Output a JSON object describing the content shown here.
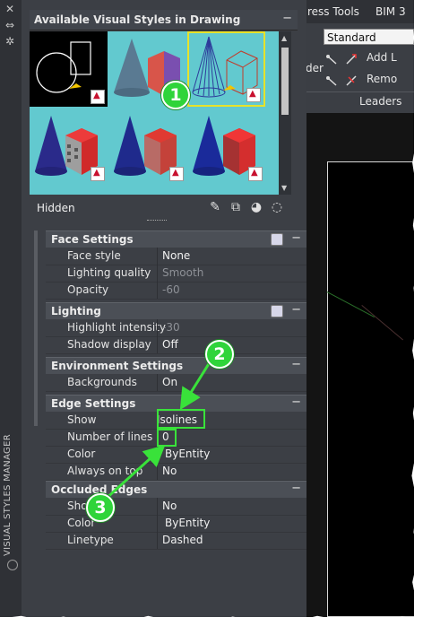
{
  "ribbon": {
    "tabs": [
      "ress Tools",
      "BIM 3"
    ],
    "dropdown_value": "Standard",
    "add_label": "Add L",
    "remove_label": "Remo",
    "left_fragment": "der",
    "panel_label": "Leaders"
  },
  "palette": {
    "side_title": "VISUAL STYLES MANAGER",
    "header_title": "Available Visual Styles in Drawing",
    "collapse_symbol": "−",
    "current_style": "Hidden",
    "thumbnails": [
      {
        "style": "2D Wireframe",
        "selected": false
      },
      {
        "style": "Conceptual",
        "selected": false
      },
      {
        "style": "Hidden",
        "selected": true
      },
      {
        "style": "X-Ray",
        "selected": false
      },
      {
        "style": "Realistic",
        "selected": false
      },
      {
        "style": "Shaded",
        "selected": false
      }
    ],
    "footer_icons": [
      "create-style-icon",
      "apply-style-icon",
      "export-tool-palette-icon",
      "delete-style-icon"
    ]
  },
  "face_settings": {
    "title": "Face Settings",
    "rows": [
      {
        "label": "Face style",
        "value": "None",
        "dim": false
      },
      {
        "label": "Lighting quality",
        "value": "Smooth",
        "dim": true
      },
      {
        "label": "Opacity",
        "value": "-60",
        "dim": true
      }
    ]
  },
  "lighting": {
    "title": "Lighting",
    "rows": [
      {
        "label": "Highlight intensity",
        "value": "-30",
        "dim": true
      },
      {
        "label": "Shadow display",
        "value": "Off",
        "dim": false
      }
    ]
  },
  "environment": {
    "title": "Environment Settings",
    "rows": [
      {
        "label": "Backgrounds",
        "value": "On",
        "dim": false
      }
    ]
  },
  "edge_settings": {
    "title": "Edge Settings",
    "rows": [
      {
        "label": "Show",
        "value": "Isolines",
        "dim": false
      },
      {
        "label": "Number of lines",
        "value": "0",
        "dim": false
      },
      {
        "label": "Color",
        "value": "ByEntity",
        "dim": false
      },
      {
        "label": "Always on top",
        "value": "No",
        "dim": false
      }
    ]
  },
  "occluded_edges": {
    "title": "Occluded Edges",
    "rows": [
      {
        "label": "Show",
        "value": "No",
        "dim": false
      },
      {
        "label": "Color",
        "value": "ByEntity",
        "dim": false
      },
      {
        "label": "Linetype",
        "value": "Dashed",
        "dim": false
      }
    ]
  },
  "annotations": {
    "callout_1": "1",
    "callout_2": "2",
    "callout_3": "3",
    "color": "#2fd43a"
  },
  "colors": {
    "palette_bg": "#3c3f45",
    "gallery_bg": "#62c9cf",
    "selection": "#e7e22a",
    "highlight": "#39e23a"
  }
}
